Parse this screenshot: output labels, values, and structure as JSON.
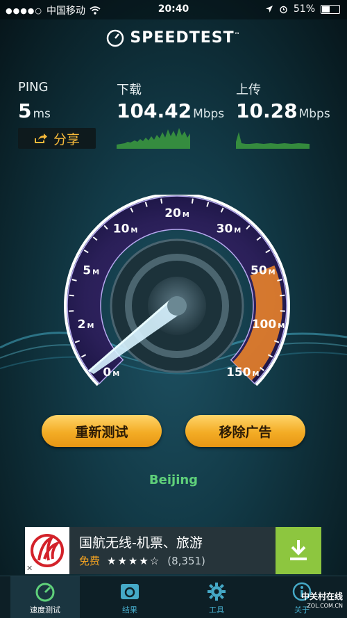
{
  "status_bar": {
    "carrier": "中国移动",
    "time": "20:40",
    "battery": "51%",
    "battery_level": 0.51
  },
  "header": {
    "title": "SPEEDTEST",
    "tm": "™"
  },
  "ping": {
    "label": "PING",
    "value": "5",
    "unit": "ms"
  },
  "download": {
    "label": "下载",
    "value": "104.42",
    "unit": "Mbps"
  },
  "upload": {
    "label": "上传",
    "value": "10.28",
    "unit": "Mbps"
  },
  "share_label": "分享",
  "gauge": {
    "ticks": [
      {
        "num": "0",
        "unit": "M"
      },
      {
        "num": "2",
        "unit": "M"
      },
      {
        "num": "5",
        "unit": "M"
      },
      {
        "num": "10",
        "unit": "M"
      },
      {
        "num": "20",
        "unit": "M"
      },
      {
        "num": "30",
        "unit": "M"
      },
      {
        "num": "50",
        "unit": "M"
      },
      {
        "num": "100",
        "unit": "M"
      },
      {
        "num": "150",
        "unit": "M"
      }
    ],
    "accent_colors": {
      "purple": "#7a4fc8",
      "orange": "#e8822a",
      "needle": "#d8f3ff"
    }
  },
  "buttons": {
    "retest": "重新测试",
    "remove_ads": "移除广告"
  },
  "location": "Beijing",
  "ad": {
    "title": "国航无线-机票、旅游",
    "price": "免费",
    "stars": "★★★★☆",
    "rating_count": "(8,351)"
  },
  "tabs": [
    {
      "label": "速度测试",
      "icon": "speedometer-icon"
    },
    {
      "label": "结果",
      "icon": "results-icon"
    },
    {
      "label": "工具",
      "icon": "gear-icon"
    },
    {
      "label": "关于",
      "icon": "info-icon"
    }
  ],
  "watermark": {
    "line1": "中关村在线",
    "line2": "ZOL.COM.CN"
  }
}
